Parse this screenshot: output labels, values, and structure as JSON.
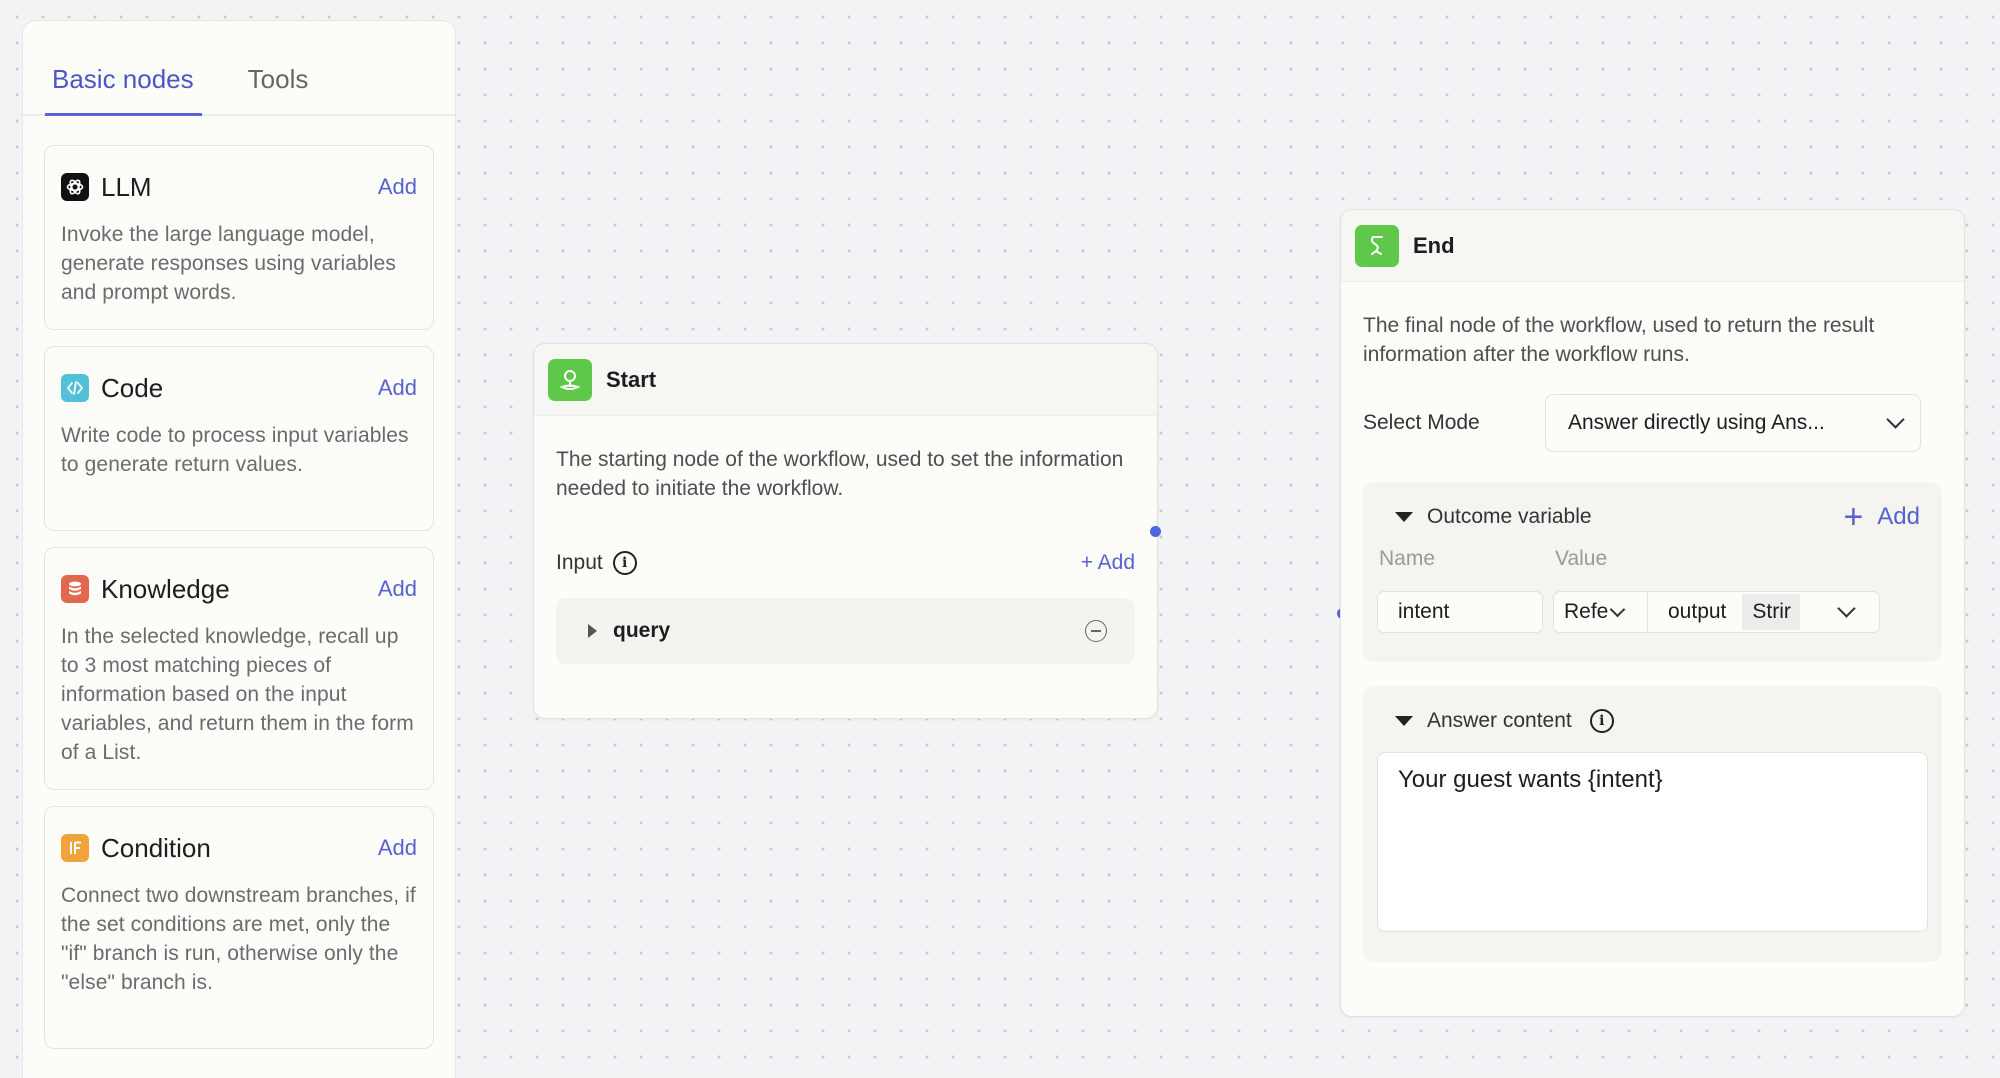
{
  "sidebar": {
    "tabs": [
      {
        "label": "Basic nodes",
        "active": true
      },
      {
        "label": "Tools",
        "active": false
      }
    ],
    "nodes": [
      {
        "title": "LLM",
        "add_label": "Add",
        "icon": "openai-icon",
        "description": "Invoke the large language model, generate responses using variables and prompt words."
      },
      {
        "title": "Code",
        "add_label": "Add",
        "icon": "code-icon",
        "description": "Write code to process input variables to generate return values."
      },
      {
        "title": "Knowledge",
        "add_label": "Add",
        "icon": "database-icon",
        "description": "In the selected knowledge, recall up to 3 most matching pieces of information based on the input variables, and return them in the form of a List."
      },
      {
        "title": "Condition",
        "add_label": "Add",
        "icon": "if-icon",
        "description": "Connect two downstream branches, if the set conditions are met, only the \"if\" branch is run, otherwise only the \"else\" branch is."
      }
    ]
  },
  "start_node": {
    "title": "Start",
    "description": "The starting node of the workflow, used to set the information needed to initiate the workflow.",
    "input_label": "Input",
    "add_label": "+ Add",
    "params": [
      {
        "name": "query"
      }
    ]
  },
  "end_node": {
    "title": "End",
    "description": "The final node of the workflow, used to return the result information after the workflow runs.",
    "select_mode_label": "Select Mode",
    "select_mode_value": "Answer directly using Ans...",
    "outcome": {
      "title": "Outcome variable",
      "add_label": "Add",
      "name_header": "Name",
      "value_header": "Value",
      "variables": [
        {
          "name": "intent",
          "ref_type": "Refe",
          "value": "output",
          "type": "Strir"
        }
      ]
    },
    "answer": {
      "title": "Answer content",
      "content": "Your guest wants {intent}"
    }
  },
  "colors": {
    "accent": "#5662cf",
    "node_green": "#5fc84a",
    "port_blue": "#4a67e0",
    "code_icon": "#52c0d6",
    "knowledge_icon": "#e2674f",
    "condition_icon": "#f0a33a"
  }
}
